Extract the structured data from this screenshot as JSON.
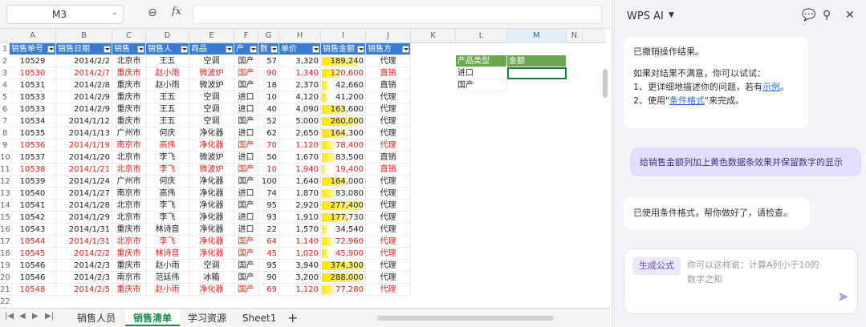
{
  "formula_bar": {
    "cell_ref": "M3",
    "zoom_icon": "zoom-icon",
    "fx_label": "fx",
    "formula": ""
  },
  "columns": [
    "A",
    "B",
    "C",
    "D",
    "E",
    "F",
    "G",
    "H",
    "I",
    "J",
    "K",
    "L",
    "M",
    "N"
  ],
  "row_numbers": [
    "1",
    "2",
    "3",
    "4",
    "5",
    "6",
    "7",
    "8",
    "9",
    "10",
    "11",
    "12",
    "13",
    "14",
    "15",
    "16",
    "17",
    "18",
    "19",
    "20",
    "21",
    "22"
  ],
  "table_headers": [
    "销售单号",
    "销售日期",
    "销售",
    "销售人",
    "商品",
    "产",
    "数",
    "单价",
    "销售金额",
    "销售方"
  ],
  "rows": [
    {
      "id": "10529",
      "date": "2014/2/2",
      "city": "北京市",
      "person": "王五",
      "product": "空调",
      "origin": "国产",
      "qty": "57",
      "price": "3,320",
      "amount": "189,240",
      "method": "代理",
      "red": false,
      "bar": 0.87
    },
    {
      "id": "10530",
      "date": "2014/2/7",
      "city": "重庆市",
      "person": "赵小雨",
      "product": "微波炉",
      "origin": "国产",
      "qty": "90",
      "price": "1,340",
      "amount": "120,600",
      "method": "直销",
      "red": true,
      "bar": 0.43
    },
    {
      "id": "10531",
      "date": "2014/2/8",
      "city": "重庆市",
      "person": "赵小雨",
      "product": "微波炉",
      "origin": "国产",
      "qty": "18",
      "price": "2,370",
      "amount": "42,660",
      "method": "直销",
      "red": false,
      "bar": 0.15
    },
    {
      "id": "10533",
      "date": "2014/2/9",
      "city": "重庆市",
      "person": "王五",
      "product": "空调",
      "origin": "进口",
      "qty": "10",
      "price": "4,120",
      "amount": "41,200",
      "method": "代理",
      "red": false,
      "bar": 0.14
    },
    {
      "id": "10533",
      "date": "2014/2/9",
      "city": "重庆市",
      "person": "王五",
      "product": "空调",
      "origin": "进口",
      "qty": "40",
      "price": "4,090",
      "amount": "163,600",
      "method": "代理",
      "red": false,
      "bar": 0.58
    },
    {
      "id": "10534",
      "date": "2014/1/12",
      "city": "重庆市",
      "person": "王五",
      "product": "空调",
      "origin": "国产",
      "qty": "52",
      "price": "5,000",
      "amount": "260,000",
      "method": "代理",
      "red": false,
      "bar": 0.93
    },
    {
      "id": "10535",
      "date": "2014/1/13",
      "city": "广州市",
      "person": "何庆",
      "product": "净化器",
      "origin": "进口",
      "qty": "62",
      "price": "2,650",
      "amount": "164,300",
      "method": "代理",
      "red": false,
      "bar": 0.59
    },
    {
      "id": "10536",
      "date": "2014/1/19",
      "city": "南京市",
      "person": "高伟",
      "product": "净化器",
      "origin": "国产",
      "qty": "70",
      "price": "1,120",
      "amount": "78,400",
      "method": "代理",
      "red": true,
      "bar": 0.28
    },
    {
      "id": "10537",
      "date": "2014/1/20",
      "city": "北京市",
      "person": "李飞",
      "product": "微波炉",
      "origin": "进口",
      "qty": "50",
      "price": "1,670",
      "amount": "83,500",
      "method": "直销",
      "red": false,
      "bar": 0.3
    },
    {
      "id": "10538",
      "date": "2014/1/21",
      "city": "北京市",
      "person": "李飞",
      "product": "微波炉",
      "origin": "国产",
      "qty": "10",
      "price": "1,940",
      "amount": "19,400",
      "method": "直销",
      "red": true,
      "bar": 0.07
    },
    {
      "id": "10539",
      "date": "2014/1/24",
      "city": "广州市",
      "person": "何庆",
      "product": "净化器",
      "origin": "国产",
      "qty": "100",
      "price": "1,640",
      "amount": "164,000",
      "method": "代理",
      "red": false,
      "bar": 0.59
    },
    {
      "id": "10540",
      "date": "2014/1/27",
      "city": "南京市",
      "person": "高伟",
      "product": "净化器",
      "origin": "进口",
      "qty": "74",
      "price": "1,870",
      "amount": "83,080",
      "method": "代理",
      "red": false,
      "bar": 0.3
    },
    {
      "id": "10541",
      "date": "2014/1/28",
      "city": "北京市",
      "person": "李飞",
      "product": "净化器",
      "origin": "国产",
      "qty": "95",
      "price": "2,920",
      "amount": "277,400",
      "method": "代理",
      "red": false,
      "bar": 0.99
    },
    {
      "id": "10542",
      "date": "2014/1/29",
      "city": "北京市",
      "person": "李飞",
      "product": "净化器",
      "origin": "进口",
      "qty": "93",
      "price": "1,910",
      "amount": "177,730",
      "method": "代理",
      "red": false,
      "bar": 0.64
    },
    {
      "id": "10543",
      "date": "2014/1/31",
      "city": "重庆市",
      "person": "林诗音",
      "product": "净化器",
      "origin": "进口",
      "qty": "22",
      "price": "1,570",
      "amount": "34,540",
      "method": "代理",
      "red": false,
      "bar": 0.12
    },
    {
      "id": "10544",
      "date": "2014/1/31",
      "city": "北京市",
      "person": "李飞",
      "product": "净化器",
      "origin": "国产",
      "qty": "64",
      "price": "1,140",
      "amount": "72,960",
      "method": "代理",
      "red": true,
      "bar": 0.26
    },
    {
      "id": "10545",
      "date": "2014/2/2",
      "city": "重庆市",
      "person": "林诗音",
      "product": "净化器",
      "origin": "国产",
      "qty": "45",
      "price": "1,020",
      "amount": "45,900",
      "method": "代理",
      "red": true,
      "bar": 0.16
    },
    {
      "id": "10546",
      "date": "2014/2/3",
      "city": "重庆市",
      "person": "赵小雨",
      "product": "空调",
      "origin": "国产",
      "qty": "95",
      "price": "3,940",
      "amount": "374,300",
      "method": "代理",
      "red": false,
      "bar": 1.0
    },
    {
      "id": "10546",
      "date": "2014/2/3",
      "city": "南京市",
      "person": "范廷伟",
      "product": "冰箱",
      "origin": "国产",
      "qty": "90",
      "price": "3,200",
      "amount": "288,000",
      "method": "代理",
      "red": false,
      "bar": 0.97
    },
    {
      "id": "10548",
      "date": "2014/2/5",
      "city": "重庆市",
      "person": "赵小雨",
      "product": "净化器",
      "origin": "国产",
      "qty": "69",
      "price": "1,120",
      "amount": "77,280",
      "method": "代理",
      "red": true,
      "bar": 0.28
    }
  ],
  "summary": {
    "header_type": "产品类型",
    "header_amount": "金额",
    "items": [
      "进口",
      "国产"
    ]
  },
  "sheet_tabs": [
    "销售人员",
    "销售清单",
    "学习资源",
    "Sheet1"
  ],
  "active_tab": "销售清单",
  "ai": {
    "title": "WPS AI",
    "msg1_line1": "已撤销操作结果。",
    "msg1_line2": "如果对结果不满意，你可以试试：",
    "msg1_line3a": "1、更详细地描述你的问题，若有",
    "msg1_line3_link": "示例",
    "msg1_line3b": "。",
    "msg1_line4a": "2、使用\"",
    "msg1_line4_link": "条件格式",
    "msg1_line4b": "\"来完成。",
    "user_msg": "给销售金额列加上黄色数据条效果并保留数字的显示",
    "msg2": "已使用条件格式，帮你做好了，请检查。",
    "chip": "生成公式",
    "placeholder": "你可以这样说：计算A列小于10的数字之和"
  }
}
